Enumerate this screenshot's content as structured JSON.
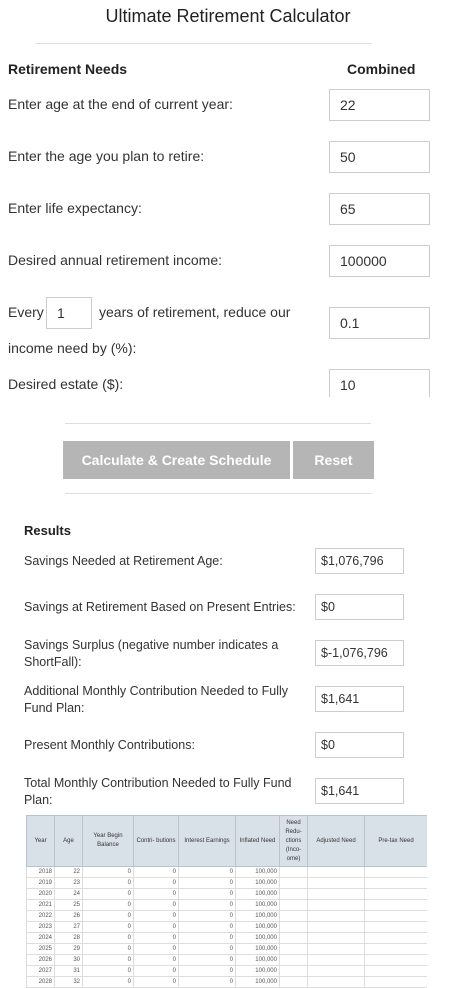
{
  "title": "Ultimate Retirement Calculator",
  "needs": {
    "heading": "Retirement Needs",
    "column": "Combined",
    "age_label": "Enter age at the end of current year:",
    "age_value": "22",
    "retire_label": "Enter the age you plan to retire:",
    "retire_value": "50",
    "life_label": "Enter life expectancy:",
    "life_value": "65",
    "income_label": "Desired annual retirement income:",
    "income_value": "100000",
    "every_label": "Every",
    "every_value": "1",
    "reduce_label": "years of retirement, reduce our",
    "reduce_label2": "income need by (%):",
    "reduce_value": "0.1",
    "estate_label": "Desired estate ($):",
    "estate_value": "10"
  },
  "buttons": {
    "calculate": "Calculate & Create Schedule",
    "reset": "Reset"
  },
  "results": {
    "heading": "Results",
    "savings_needed_label": "Savings Needed at Retirement Age:",
    "savings_needed_value": "$1,076,796",
    "savings_present_label": "Savings at Retirement Based on Present Entries:",
    "savings_present_value": "$0",
    "surplus_label": "Savings Surplus (negative number indicates a ShortFall):",
    "surplus_value": "$-1,076,796",
    "additional_label": "Additional Monthly Contribution Needed to Fully Fund Plan:",
    "additional_value": "$1,641",
    "present_contrib_label": "Present Monthly Contributions:",
    "present_contrib_value": "$0",
    "total_label": "Total Monthly Contribution Needed to Fully Fund Plan:",
    "total_value": "$1,641"
  },
  "schedule": {
    "headers": [
      "Year",
      "Age",
      "Year Begin Balance",
      "Contri- butions",
      "Interest Earnings",
      "Inflated Need",
      "Need Redu- ctions (Inco- ome)",
      "Adjusted Need",
      "Pre-tax Need"
    ],
    "rows": [
      [
        "2018",
        "22",
        "0",
        "0",
        "0",
        "100,000",
        "",
        "",
        ""
      ],
      [
        "2019",
        "23",
        "0",
        "0",
        "0",
        "100,000",
        "",
        "",
        ""
      ],
      [
        "2020",
        "24",
        "0",
        "0",
        "0",
        "100,000",
        "",
        "",
        ""
      ],
      [
        "2021",
        "25",
        "0",
        "0",
        "0",
        "100,000",
        "",
        "",
        ""
      ],
      [
        "2022",
        "26",
        "0",
        "0",
        "0",
        "100,000",
        "",
        "",
        ""
      ],
      [
        "2023",
        "27",
        "0",
        "0",
        "0",
        "100,000",
        "",
        "",
        ""
      ],
      [
        "2024",
        "28",
        "0",
        "0",
        "0",
        "100,000",
        "",
        "",
        ""
      ],
      [
        "2025",
        "29",
        "0",
        "0",
        "0",
        "100,000",
        "",
        "",
        ""
      ],
      [
        "2026",
        "30",
        "0",
        "0",
        "0",
        "100,000",
        "",
        "",
        ""
      ],
      [
        "2027",
        "31",
        "0",
        "0",
        "0",
        "100,000",
        "",
        "",
        ""
      ],
      [
        "2028",
        "32",
        "0",
        "0",
        "0",
        "100,000",
        "",
        "",
        ""
      ]
    ]
  }
}
